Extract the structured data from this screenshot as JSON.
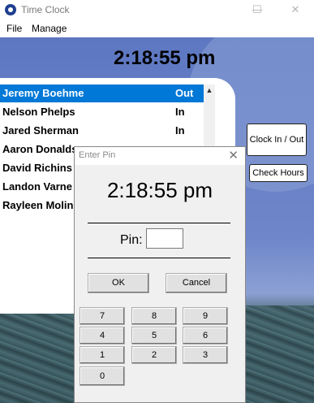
{
  "window": {
    "title": "Time Clock",
    "controls": {
      "minimize": "—",
      "maximize": "☐",
      "close": "✕"
    }
  },
  "menu": [
    "File",
    "Manage"
  ],
  "clock": {
    "time": "2:18:55 pm"
  },
  "employees": [
    {
      "name": "Jeremy Boehme",
      "status": "Out",
      "selected": true
    },
    {
      "name": "Nelson Phelps",
      "status": "In"
    },
    {
      "name": "Jared Sherman",
      "status": "In"
    },
    {
      "name": "Aaron Donalds",
      "status": ""
    },
    {
      "name": "David Richins",
      "status": ""
    },
    {
      "name": "Landon Varne",
      "status": ""
    },
    {
      "name": "Rayleen Molin",
      "status": ""
    }
  ],
  "side_buttons": {
    "clock_in_out": "Clock In / Out",
    "check_hours": "Check Hours"
  },
  "dialog": {
    "title": "Enter Pin",
    "time": "2:18:55 pm",
    "pin_label": "Pin:",
    "pin_value": "",
    "ok": "OK",
    "cancel": "Cancel",
    "keypad": [
      "7",
      "8",
      "9",
      "4",
      "5",
      "6",
      "1",
      "2",
      "3",
      "0"
    ]
  },
  "colors": {
    "selection": "#0078d7",
    "background_blue": "#6f86c9"
  }
}
